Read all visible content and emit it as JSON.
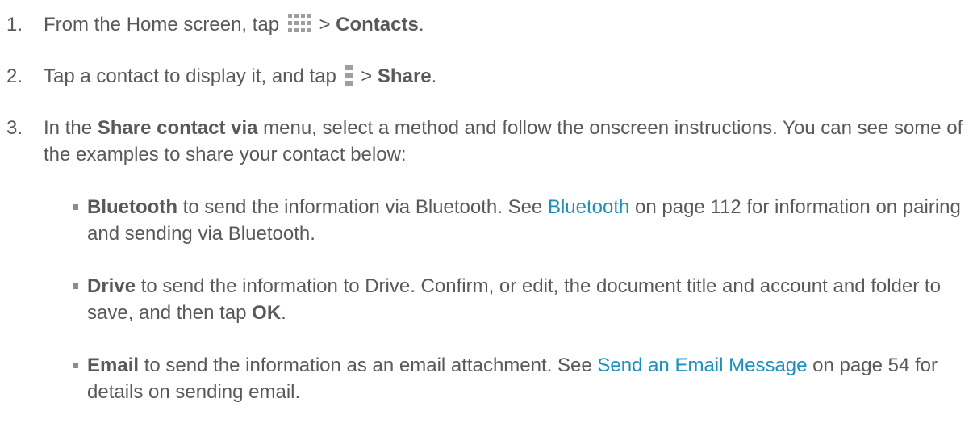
{
  "steps": [
    {
      "number": "1.",
      "parts": [
        "From the Home screen, tap ",
        " > ",
        "Contacts",
        "."
      ],
      "icon": "apps-grid-icon"
    },
    {
      "number": "2.",
      "parts": [
        "Tap a contact to display it, and tap ",
        " > ",
        "Share",
        "."
      ],
      "icon": "menu-dots-icon"
    },
    {
      "number": "3.",
      "parts": [
        "In the ",
        "Share contact via",
        " menu, select a method and follow the onscreen instructions. You can see some of the examples to share your contact below:"
      ]
    }
  ],
  "bullets": [
    {
      "term": "Bluetooth",
      "text1": " to send the information via Bluetooth. See ",
      "link": "Bluetooth",
      "text2": " on page 112 for information on pairing and sending via Bluetooth."
    },
    {
      "term": "Drive",
      "text1": " to send the information to Drive. Confirm, or edit, the document title and account and folder to save, and then tap ",
      "bold2": "OK",
      "text2": "."
    },
    {
      "term": "Email",
      "text1": " to send the information as an email attachment. See ",
      "link": "Send an Email Message",
      "text2": " on page 54 for details on sending email."
    }
  ],
  "colors": {
    "text": "#595959",
    "link": "#1d8fbf",
    "icon": "#9e9e9e"
  }
}
